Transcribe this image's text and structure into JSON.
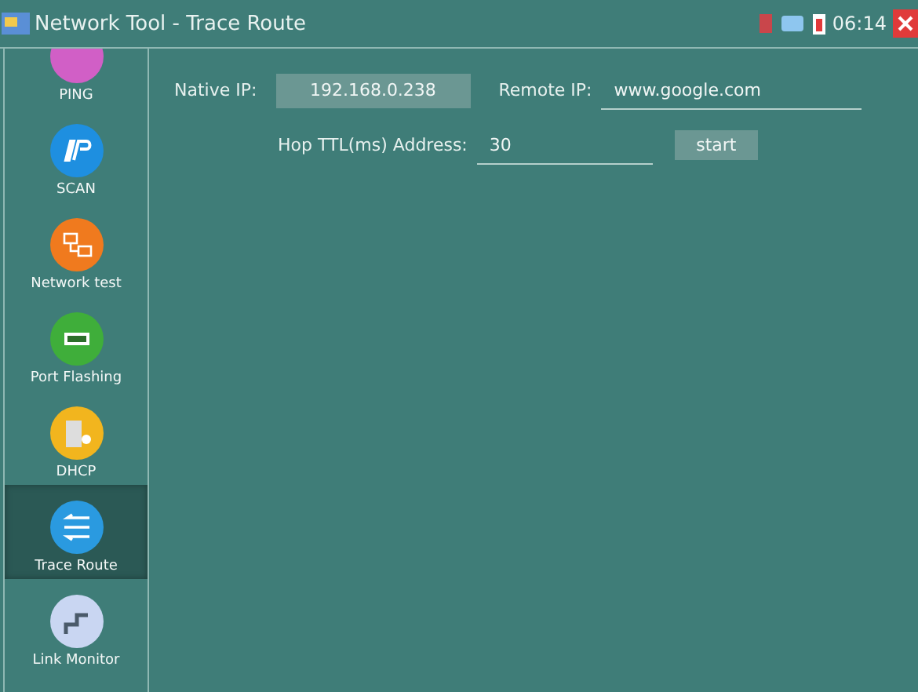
{
  "window": {
    "title": "Network Tool - Trace Route"
  },
  "status_bar": {
    "time": "06:14"
  },
  "sidebar": {
    "items": [
      {
        "label": "PING",
        "kind": "ping",
        "color": "#d15fc6",
        "selected": false
      },
      {
        "label": "SCAN",
        "kind": "scan",
        "color": "#1e8fe0",
        "selected": false
      },
      {
        "label": "Network test",
        "kind": "network",
        "color": "#f07a1e",
        "selected": false
      },
      {
        "label": "Port Flashing",
        "kind": "port",
        "color": "#3fae3a",
        "selected": false
      },
      {
        "label": "DHCP",
        "kind": "dhcp",
        "color": "#f2b51e",
        "selected": false
      },
      {
        "label": "Trace Route",
        "kind": "trace",
        "color": "#2a9ae0",
        "selected": true
      },
      {
        "label": "Link Monitor",
        "kind": "link",
        "color": "#c9d6f2",
        "selected": false
      }
    ]
  },
  "form": {
    "native_ip_label": "Native IP:",
    "native_ip": "192.168.0.238",
    "remote_ip_label": "Remote IP:",
    "remote_ip": "www.google.com",
    "hop_label": "Hop TTL(ms) Address:",
    "hop": "30",
    "start_button": "start"
  }
}
